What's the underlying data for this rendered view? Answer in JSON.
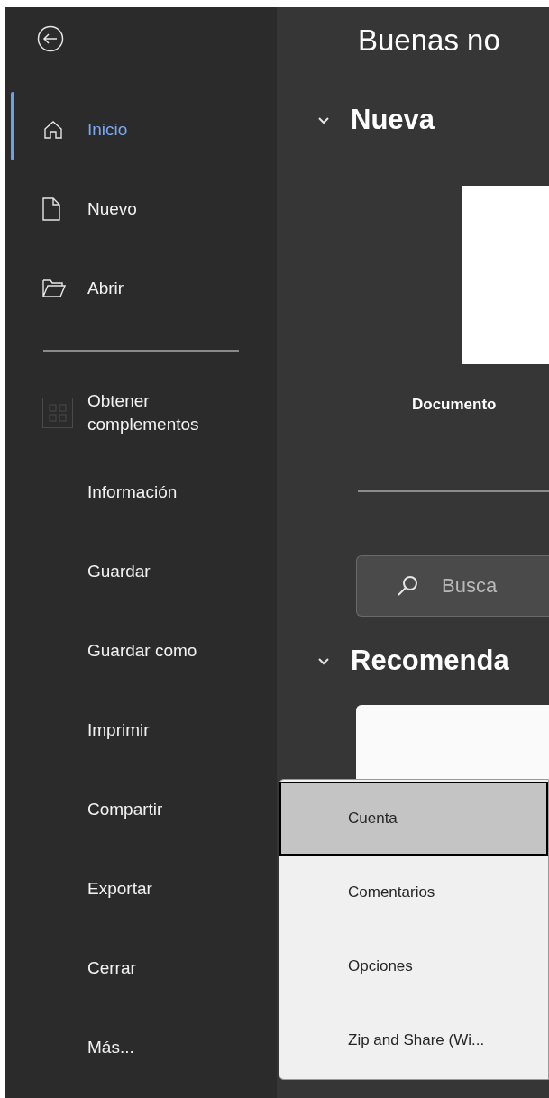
{
  "sidebar": {
    "items": [
      {
        "kind": "home",
        "label": "Inicio",
        "selected": true
      },
      {
        "kind": "file",
        "label": "Nuevo",
        "selected": false
      },
      {
        "kind": "folder",
        "label": "Abrir",
        "selected": false
      },
      {
        "kind": "divider"
      },
      {
        "kind": "addins",
        "label": "Obtener complementos",
        "selected": false
      },
      {
        "kind": "text",
        "label": "Información",
        "selected": false
      },
      {
        "kind": "text",
        "label": "Guardar",
        "selected": false
      },
      {
        "kind": "text",
        "label": "Guardar como",
        "selected": false
      },
      {
        "kind": "text",
        "label": "Imprimir",
        "selected": false
      },
      {
        "kind": "text",
        "label": "Compartir",
        "selected": false
      },
      {
        "kind": "text",
        "label": "Exportar",
        "selected": false
      },
      {
        "kind": "text",
        "label": "Cerrar",
        "selected": false
      },
      {
        "kind": "text",
        "label": "Más...",
        "selected": false
      }
    ]
  },
  "main": {
    "greeting": "Buenas no",
    "new_section": {
      "title": "Nueva",
      "expanded": true,
      "template_label": "Documento"
    },
    "search": {
      "placeholder": "Busca"
    },
    "recommended_section": {
      "title": "Recomenda",
      "expanded": true
    }
  },
  "more_menu": {
    "items": [
      {
        "label": "Cuenta",
        "selected": true
      },
      {
        "label": "Comentarios",
        "selected": false
      },
      {
        "label": "Opciones",
        "selected": false
      },
      {
        "label": "Zip and Share (Wi...",
        "selected": false
      }
    ]
  }
}
